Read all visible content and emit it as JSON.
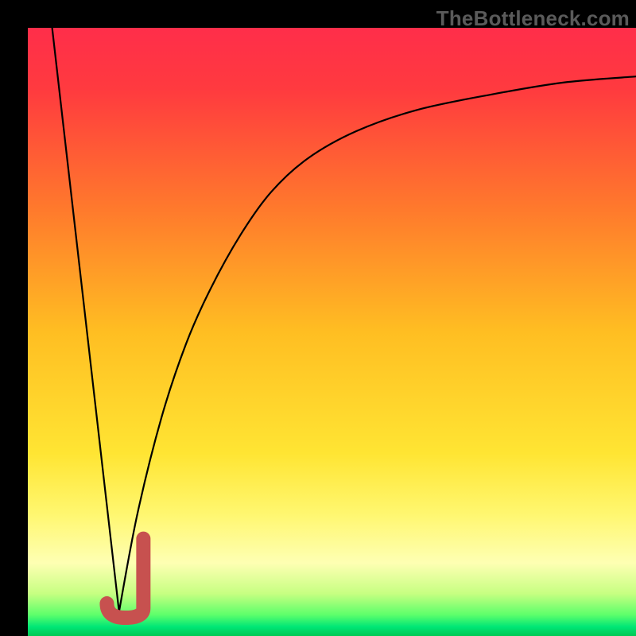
{
  "watermark": "TheBottleneck.com",
  "colors": {
    "black": "#000000",
    "curve": "#000000",
    "hook": "#c7514f",
    "gradient_stops": [
      {
        "offset": 0.0,
        "color": "#ff2e4a"
      },
      {
        "offset": 0.1,
        "color": "#ff3a3f"
      },
      {
        "offset": 0.3,
        "color": "#ff7a2c"
      },
      {
        "offset": 0.5,
        "color": "#ffbe22"
      },
      {
        "offset": 0.7,
        "color": "#ffe533"
      },
      {
        "offset": 0.8,
        "color": "#fff770"
      },
      {
        "offset": 0.88,
        "color": "#feffb3"
      },
      {
        "offset": 0.93,
        "color": "#c7ff82"
      },
      {
        "offset": 0.965,
        "color": "#5eff6b"
      },
      {
        "offset": 0.985,
        "color": "#00e676"
      },
      {
        "offset": 1.0,
        "color": "#00c853"
      }
    ]
  },
  "chart_data": {
    "type": "line",
    "title": "",
    "xlabel": "",
    "ylabel": "",
    "xlim": [
      0,
      100
    ],
    "ylim": [
      0,
      100
    ],
    "series": [
      {
        "name": "left-descent",
        "x": [
          4,
          15
        ],
        "values": [
          100,
          4
        ]
      },
      {
        "name": "right-ascent",
        "x": [
          15,
          18,
          22,
          26,
          30,
          35,
          40,
          46,
          54,
          64,
          76,
          88,
          100
        ],
        "values": [
          4,
          20,
          36,
          48,
          57,
          66,
          73,
          78.5,
          83,
          86.5,
          89,
          91,
          92
        ]
      }
    ],
    "annotations": [
      {
        "name": "hook-marker",
        "shape": "J",
        "x_range": [
          13,
          19
        ],
        "y_range": [
          3,
          16
        ],
        "color": "#c7514f"
      }
    ]
  }
}
